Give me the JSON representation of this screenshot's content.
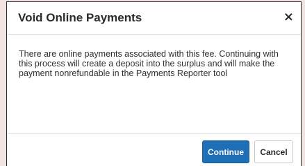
{
  "dialog": {
    "title": "Void Online Payments",
    "close_symbol": "×",
    "close_icon": "close-icon",
    "message": "There are online payments associated with this fee. Continuing with this process will create a deposit into the surplus and will make the payment nonrefundable in the Payments Reporter tool",
    "buttons": {
      "continue_label": "Continue",
      "cancel_label": "Cancel"
    }
  },
  "colors": {
    "primary_button": "#1f6fb7",
    "page_background": "#f3e4e4"
  }
}
